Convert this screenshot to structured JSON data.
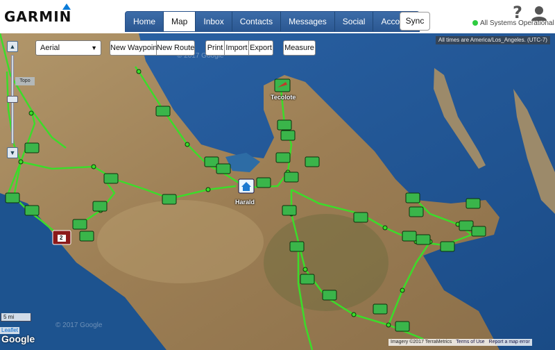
{
  "brand": {
    "name": "GARMIN"
  },
  "nav": {
    "tabs": [
      {
        "label": "Home",
        "active": false
      },
      {
        "label": "Map",
        "active": true
      },
      {
        "label": "Inbox",
        "active": false
      },
      {
        "label": "Contacts",
        "active": false
      },
      {
        "label": "Messages",
        "active": false
      },
      {
        "label": "Social",
        "active": false
      },
      {
        "label": "Account",
        "active": false
      }
    ],
    "sync_label": "Sync"
  },
  "header": {
    "help_icon": "help-icon",
    "user_icon": "user-icon",
    "status_text": "All Systems Operational",
    "status_color": "#2ecc40"
  },
  "map": {
    "layer_select": {
      "value": "Aerial"
    },
    "toolbar": {
      "new_waypoint": "New Waypoint",
      "new_route": "New Route",
      "print": "Print",
      "import": "Import",
      "export": "Export",
      "measure": "Measure"
    },
    "zoom": {
      "in": "▲",
      "out": "▼",
      "topo_label": "Topo"
    },
    "timezone_note": "All times are America/Los_Angeles. (UTC-7)",
    "scale": "5 mi",
    "places": {
      "tecolote": "Tecolote",
      "harald": "Harald"
    },
    "cluster_count": "2",
    "watermark": "© 2017 Google",
    "leaflet": "Leaflet",
    "google": "Google",
    "attribution": {
      "imagery": "Imagery ©2017 TerraMetrics",
      "terms": "Terms of Use",
      "report": "Report a map error"
    },
    "colors": {
      "sea": "#1f5a9b",
      "land": "#a4885c",
      "track": "#3cdc2a",
      "waypoint": "#3ab54a"
    }
  }
}
